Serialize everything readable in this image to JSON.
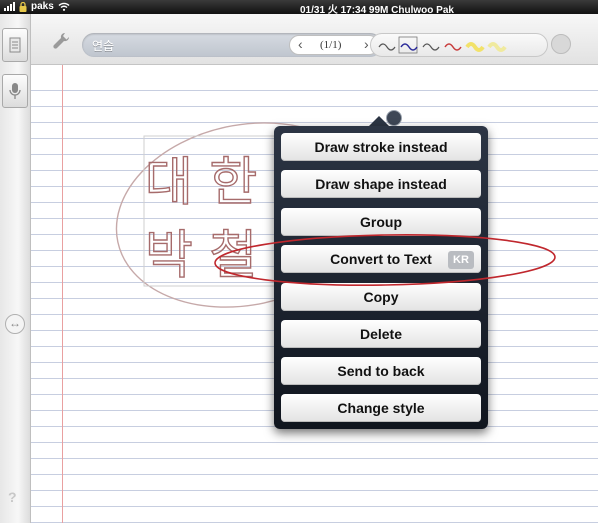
{
  "status_bar": {
    "carrier": "paks",
    "datetime_user": "01/31 火 17:34 99M Chulwoo Pak"
  },
  "toolbar": {
    "note_title": "연습",
    "page_indicator": "(1/1)",
    "prev_icon": "chevron-left-icon",
    "next_icon": "chevron-right-icon",
    "pen_colors": [
      "#555555",
      "#555555",
      "#2b2b9a",
      "#555555",
      "#c83c3c",
      "#f2e26a",
      "#f0ea9e"
    ]
  },
  "handwriting": {
    "row1": "대 한",
    "row2": "박 철",
    "ink_color": "#a66b6b"
  },
  "context_menu": {
    "items": [
      {
        "label": "Draw stroke instead"
      },
      {
        "label": "Draw shape instead"
      },
      {
        "label": "Group"
      },
      {
        "label": "Convert to Text",
        "badge": "KR"
      },
      {
        "label": "Copy"
      },
      {
        "label": "Delete"
      },
      {
        "label": "Send to back"
      },
      {
        "label": "Change style"
      }
    ]
  },
  "highlight_color": "#c0272d"
}
